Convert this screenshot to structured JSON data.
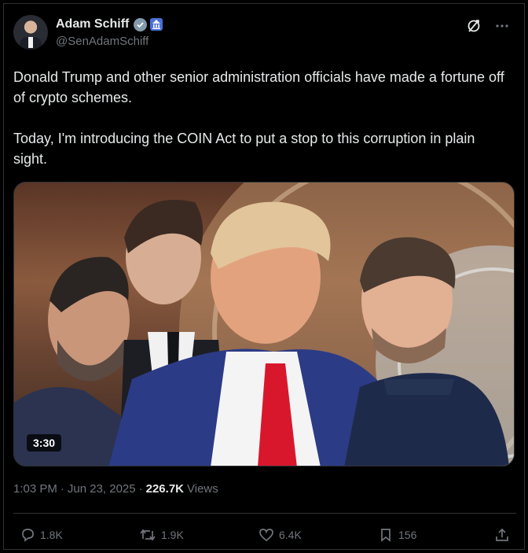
{
  "author": {
    "display_name": "Adam Schiff",
    "handle": "@SenAdamSchiff"
  },
  "tweet": {
    "text": "Donald Trump and other senior administration officials have made a fortune off of crypto schemes.\n\nToday, I'm introducing the COIN Act to put a stop to this corruption in plain sight."
  },
  "media": {
    "duration": "3:30"
  },
  "meta": {
    "time": "1:03 PM",
    "date": "Jun 23, 2025",
    "views_count": "226.7K",
    "views_label": "Views"
  },
  "actions": {
    "replies": "1.8K",
    "reposts": "1.9K",
    "likes": "6.4K",
    "bookmarks": "156"
  },
  "icons": [
    "verified-icon",
    "government-badge-icon",
    "grok-icon",
    "more-icon",
    "reply-icon",
    "repost-icon",
    "like-icon",
    "bookmark-icon",
    "share-icon"
  ],
  "colors": {
    "background": "#000000",
    "text": "#e7e9ea",
    "secondary_text": "#71767b",
    "border": "#2f3336",
    "verified": "#829aab"
  }
}
